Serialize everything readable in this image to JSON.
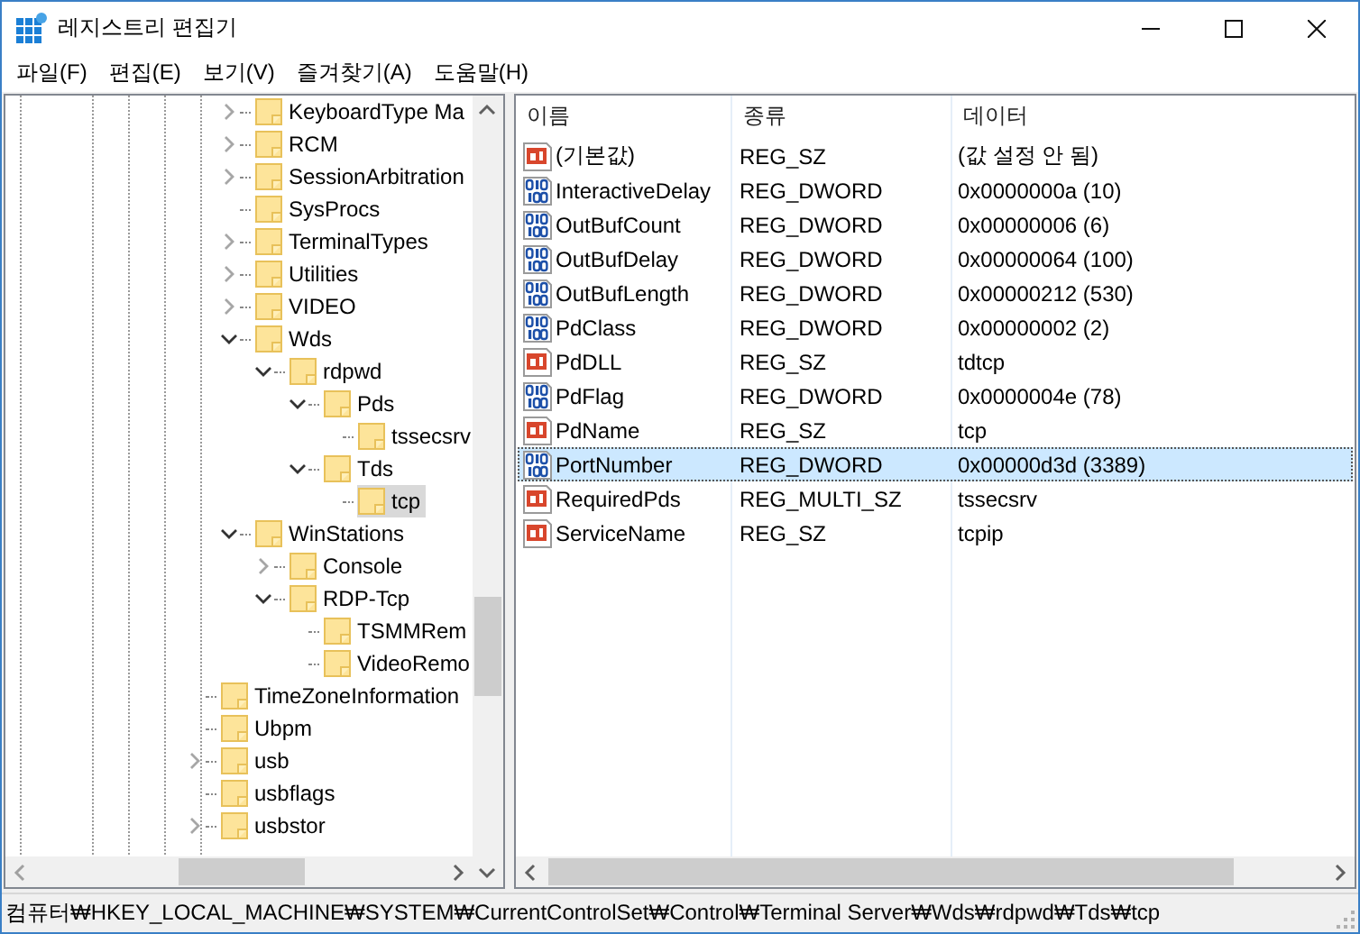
{
  "window": {
    "title": "레지스트리 편집기"
  },
  "menu": [
    "파일(F)",
    "편집(E)",
    "보기(V)",
    "즐겨찾기(A)",
    "도움말(H)"
  ],
  "tree": {
    "items": [
      {
        "children": [
          {
            "label": "KeyboardType Ma",
            "expanded": false,
            "selected": false
          },
          {
            "label": "RCM",
            "expanded": false,
            "selected": false
          },
          {
            "label": "SessionArbitration",
            "expanded": false,
            "selected": false
          },
          {
            "label": "SysProcs",
            "selected": false
          },
          {
            "label": "TerminalTypes",
            "expanded": false,
            "selected": false
          },
          {
            "label": "Utilities",
            "expanded": false,
            "selected": false
          },
          {
            "label": "VIDEO",
            "expanded": false,
            "selected": false
          },
          {
            "label": "Wds",
            "expanded": true,
            "selected": false,
            "children": [
              {
                "label": "rdpwd",
                "expanded": true,
                "selected": false,
                "children": [
                  {
                    "label": "Pds",
                    "expanded": true,
                    "selected": false,
                    "children": [
                      {
                        "label": "tssecsrv",
                        "selected": false
                      }
                    ]
                  },
                  {
                    "label": "Tds",
                    "expanded": true,
                    "selected": false,
                    "children": [
                      {
                        "label": "tcp",
                        "selected": true
                      }
                    ]
                  }
                ]
              }
            ]
          },
          {
            "label": "WinStations",
            "expanded": true,
            "selected": false,
            "children": [
              {
                "label": "Console",
                "expanded": false,
                "selected": false
              },
              {
                "label": "RDP-Tcp",
                "expanded": true,
                "selected": false,
                "children": [
                  {
                    "label": "TSMMRem",
                    "selected": false
                  },
                  {
                    "label": "VideoRemo",
                    "selected": false
                  }
                ]
              }
            ]
          }
        ]
      },
      {
        "label": "TimeZoneInformation",
        "selected": false
      },
      {
        "label": "Ubpm",
        "selected": false
      },
      {
        "label": "usb",
        "expanded": false,
        "selected": false
      },
      {
        "label": "usbflags",
        "selected": false
      },
      {
        "label": "usbstor",
        "expanded": false,
        "selected": false
      }
    ]
  },
  "values": {
    "columns": [
      "이름",
      "종류",
      "데이터"
    ],
    "rows": [
      {
        "kind": "string",
        "name": "(기본값)",
        "type": "REG_SZ",
        "data": "(값 설정 안 됨)",
        "selected": false
      },
      {
        "kind": "dword",
        "name": "InteractiveDelay",
        "type": "REG_DWORD",
        "data": "0x0000000a (10)",
        "selected": false
      },
      {
        "kind": "dword",
        "name": "OutBufCount",
        "type": "REG_DWORD",
        "data": "0x00000006 (6)",
        "selected": false
      },
      {
        "kind": "dword",
        "name": "OutBufDelay",
        "type": "REG_DWORD",
        "data": "0x00000064 (100)",
        "selected": false
      },
      {
        "kind": "dword",
        "name": "OutBufLength",
        "type": "REG_DWORD",
        "data": "0x00000212 (530)",
        "selected": false
      },
      {
        "kind": "dword",
        "name": "PdClass",
        "type": "REG_DWORD",
        "data": "0x00000002 (2)",
        "selected": false
      },
      {
        "kind": "string",
        "name": "PdDLL",
        "type": "REG_SZ",
        "data": "tdtcp",
        "selected": false
      },
      {
        "kind": "dword",
        "name": "PdFlag",
        "type": "REG_DWORD",
        "data": "0x0000004e (78)",
        "selected": false
      },
      {
        "kind": "string",
        "name": "PdName",
        "type": "REG_SZ",
        "data": "tcp",
        "selected": false
      },
      {
        "kind": "dword",
        "name": "PortNumber",
        "type": "REG_DWORD",
        "data": "0x00000d3d (3389)",
        "selected": true
      },
      {
        "kind": "string",
        "name": "RequiredPds",
        "type": "REG_MULTI_SZ",
        "data": "tssecsrv",
        "selected": false
      },
      {
        "kind": "string",
        "name": "ServiceName",
        "type": "REG_SZ",
        "data": "tcpip",
        "selected": false
      }
    ]
  },
  "status_bar": "컴퓨터₩HKEY_LOCAL_MACHINE₩SYSTEM₩CurrentControlSet₩Control₩Terminal Server₩Wds₩rdpwd₩Tds₩tcp"
}
